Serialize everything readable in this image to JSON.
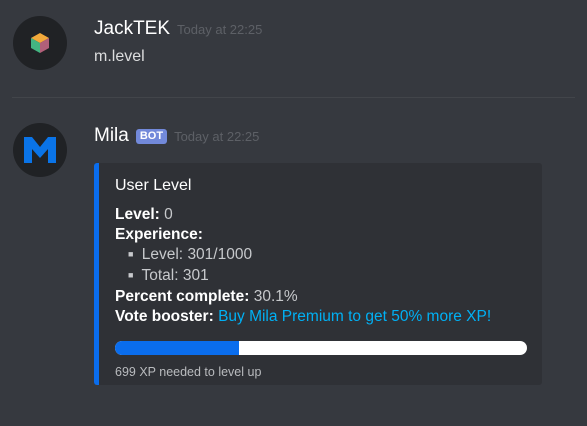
{
  "messages": [
    {
      "username": "JackTEK",
      "timestamp": "Today at 22:25",
      "content": "m.level",
      "avatar_icon": "colorful-cube-icon"
    },
    {
      "username": "Mila",
      "bot_tag": "BOT",
      "timestamp": "Today at 22:25",
      "avatar_icon": "mila-m-logo-icon",
      "embed": {
        "accent_color": "#0a6ded",
        "title": "User Level",
        "level_label": "Level:",
        "level_value": "0",
        "experience_label": "Experience:",
        "exp_level_label": "Level:",
        "exp_level_value": "301/1000",
        "exp_total_label": "Total:",
        "exp_total_value": "301",
        "percent_label": "Percent complete:",
        "percent_value": "30.1%",
        "vote_label": "Vote booster:",
        "vote_link": "Buy Mila Premium to get 50% more XP!",
        "progress_fraction": 0.301,
        "footer": "699 XP needed to level up"
      }
    }
  ],
  "colors": {
    "background": "#36393f",
    "embed_background": "#2f3136",
    "link": "#00b0f4",
    "bot_tag": "#7289da"
  }
}
